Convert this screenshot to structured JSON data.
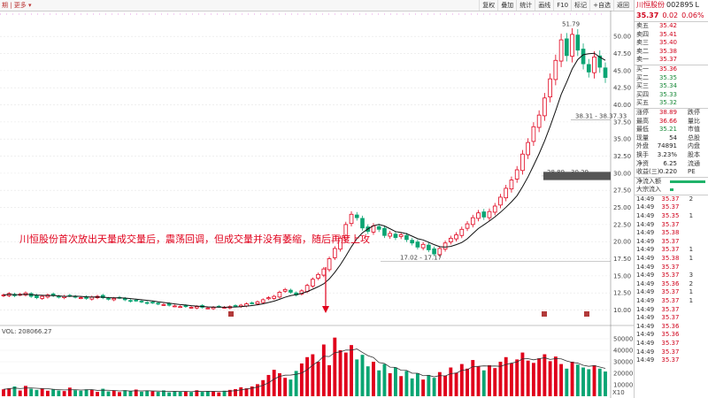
{
  "toolbar": {
    "left_text": "期 | 更多 ▾",
    "tabs": [
      "复权",
      "叠加",
      "统计",
      "画线",
      "F10",
      "标记",
      "+自选",
      "返回"
    ]
  },
  "stock": {
    "name": "川恒股份",
    "code": "002895",
    "suffix": "L",
    "price": "35.37",
    "change": "0.02",
    "pct": "0.06%"
  },
  "orderbook": {
    "sell": [
      {
        "label": "卖五",
        "price": "35.42"
      },
      {
        "label": "卖四",
        "price": "35.41"
      },
      {
        "label": "卖三",
        "price": "35.40"
      },
      {
        "label": "卖二",
        "price": "35.38"
      },
      {
        "label": "卖一",
        "price": "35.37"
      }
    ],
    "buy": [
      {
        "label": "买一",
        "price": "35.36"
      },
      {
        "label": "买二",
        "price": "35.35"
      },
      {
        "label": "买三",
        "price": "35.34"
      },
      {
        "label": "买四",
        "price": "35.33"
      },
      {
        "label": "买五",
        "price": "35.32"
      }
    ]
  },
  "stats": [
    {
      "label": "涨停",
      "value": "38.89",
      "label2": "跌停"
    },
    {
      "label": "最高",
      "value": "36.66",
      "label2": "量比"
    },
    {
      "label": "最低",
      "value": "35.21",
      "label2": "市值"
    },
    {
      "label": "现量",
      "value": "54",
      "label2": "总股"
    },
    {
      "label": "外盘",
      "value": "74891",
      "label2": "内盘"
    },
    {
      "label": "换手",
      "value": "3.23%",
      "label2": "股本"
    },
    {
      "label": "净资",
      "value": "6.25",
      "label2": "流通"
    },
    {
      "label": "收益(三)",
      "value": "0.220",
      "label2": "PE"
    }
  ],
  "flow": [
    {
      "label": "净流入额",
      "value": ""
    },
    {
      "label": "大宗流入",
      "value": ""
    }
  ],
  "ticks": [
    {
      "t": "14:49",
      "p": "35.37",
      "v": "2"
    },
    {
      "t": "14:49",
      "p": "35.37",
      "v": ""
    },
    {
      "t": "14:49",
      "p": "35.35",
      "v": "1"
    },
    {
      "t": "14:49",
      "p": "35.37",
      "v": ""
    },
    {
      "t": "14:49",
      "p": "35.38",
      "v": ""
    },
    {
      "t": "14:49",
      "p": "35.37",
      "v": ""
    },
    {
      "t": "14:49",
      "p": "35.37",
      "v": "1"
    },
    {
      "t": "14:49",
      "p": "35.38",
      "v": "1"
    },
    {
      "t": "14:49",
      "p": "35.37",
      "v": ""
    },
    {
      "t": "14:49",
      "p": "35.37",
      "v": "3"
    },
    {
      "t": "14:49",
      "p": "35.36",
      "v": "2"
    },
    {
      "t": "14:49",
      "p": "35.37",
      "v": "1"
    },
    {
      "t": "14:49",
      "p": "35.37",
      "v": "1"
    },
    {
      "t": "14:49",
      "p": "35.37",
      "v": ""
    },
    {
      "t": "14:49",
      "p": "35.37",
      "v": ""
    },
    {
      "t": "14:49",
      "p": "35.36",
      "v": ""
    },
    {
      "t": "14:49",
      "p": "35.36",
      "v": ""
    },
    {
      "t": "14:49",
      "p": "35.37",
      "v": ""
    },
    {
      "t": "14:49",
      "p": "35.37",
      "v": ""
    },
    {
      "t": "14:49",
      "p": "35.37",
      "v": ""
    }
  ],
  "annotation": "川恒股份首次放出天量成交量后，震荡回调，但成交量并没有萎缩，随后再度上攻",
  "chart_data": [
    {
      "type": "candlestick",
      "ylim": [
        8,
        53
      ],
      "yticks": [
        10.0,
        12.5,
        15.0,
        17.5,
        20.0,
        22.5,
        25.0,
        27.5,
        30.0,
        32.5,
        35.0,
        37.5,
        40.0,
        42.5,
        45.0,
        47.5,
        50.0
      ],
      "annotations": [
        "51.79",
        "38.31 - 38.37.33",
        "28.89 - 30.29",
        "17.02 - 17.17"
      ],
      "close": [
        12.2,
        12.4,
        12.1,
        12.3,
        12.5,
        12.0,
        11.8,
        12.0,
        12.2,
        12.1,
        11.9,
        12.0,
        12.1,
        11.9,
        11.8,
        11.7,
        11.9,
        12.0,
        11.8,
        11.6,
        11.7,
        11.8,
        11.5,
        11.3,
        11.4,
        11.2,
        11.0,
        11.1,
        10.9,
        10.8,
        10.7,
        10.6,
        10.5,
        10.5,
        10.4,
        10.5,
        10.4,
        10.3,
        10.4,
        10.5,
        10.4,
        10.5,
        10.6,
        10.7,
        10.9,
        11.0,
        11.2,
        11.5,
        11.8,
        12.0,
        12.6,
        13.0,
        12.6,
        12.2,
        12.8,
        13.6,
        14.5,
        15.2,
        16.0,
        17.5,
        19.0,
        20.5,
        22.5,
        24.0,
        23.5,
        22.0,
        21.5,
        22.3,
        21.8,
        20.9,
        21.2,
        20.6,
        21.0,
        20.3,
        19.8,
        19.2,
        19.6,
        18.8,
        18.2,
        19.0,
        19.8,
        20.5,
        21.0,
        21.8,
        22.6,
        23.5,
        24.2,
        23.6,
        24.4,
        25.2,
        26.5,
        27.8,
        29.0,
        30.5,
        32.8,
        34.5,
        36.8,
        38.5,
        41.0,
        43.8,
        46.5,
        49.5,
        47.2,
        50.3,
        48.0,
        46.0,
        44.8,
        47.0,
        45.5,
        44.0
      ],
      "vol_ylim": [
        0,
        60000
      ],
      "vol_yticks": [
        10000,
        20000,
        30000,
        40000,
        50000
      ],
      "vol_unit": "X10",
      "vol_label": "VOL: 208066.27",
      "volume": [
        6000,
        7000,
        8500,
        5000,
        9000,
        6500,
        5500,
        7000,
        4800,
        6200,
        5000,
        4500,
        7500,
        5200,
        4800,
        6000,
        5400,
        3800,
        6500,
        4200,
        5000,
        3600,
        5200,
        4400,
        5800,
        3900,
        4600,
        4200,
        3800,
        5100,
        3400,
        4500,
        3900,
        4200,
        3600,
        5200,
        3800,
        4600,
        4100,
        3400,
        4800,
        5500,
        6200,
        7800,
        6900,
        8500,
        10500,
        14000,
        18500,
        23000,
        20000,
        16000,
        14500,
        22000,
        28500,
        34000,
        36500,
        30000,
        45000,
        27000,
        51000,
        40000,
        38000,
        44500,
        32000,
        36000,
        26000,
        30000,
        22500,
        28000,
        20000,
        25000,
        17500,
        22000,
        15500,
        20000,
        14500,
        18500,
        16000,
        21000,
        18000,
        25000,
        20500,
        28000,
        24000,
        31500,
        26000,
        22500,
        27000,
        24500,
        30000,
        34000,
        28500,
        32000,
        38000,
        31000,
        29000,
        33000,
        36500,
        30500,
        34500,
        28000,
        24000,
        30000,
        27500,
        25000,
        23500,
        27000,
        24000,
        21500
      ]
    }
  ]
}
